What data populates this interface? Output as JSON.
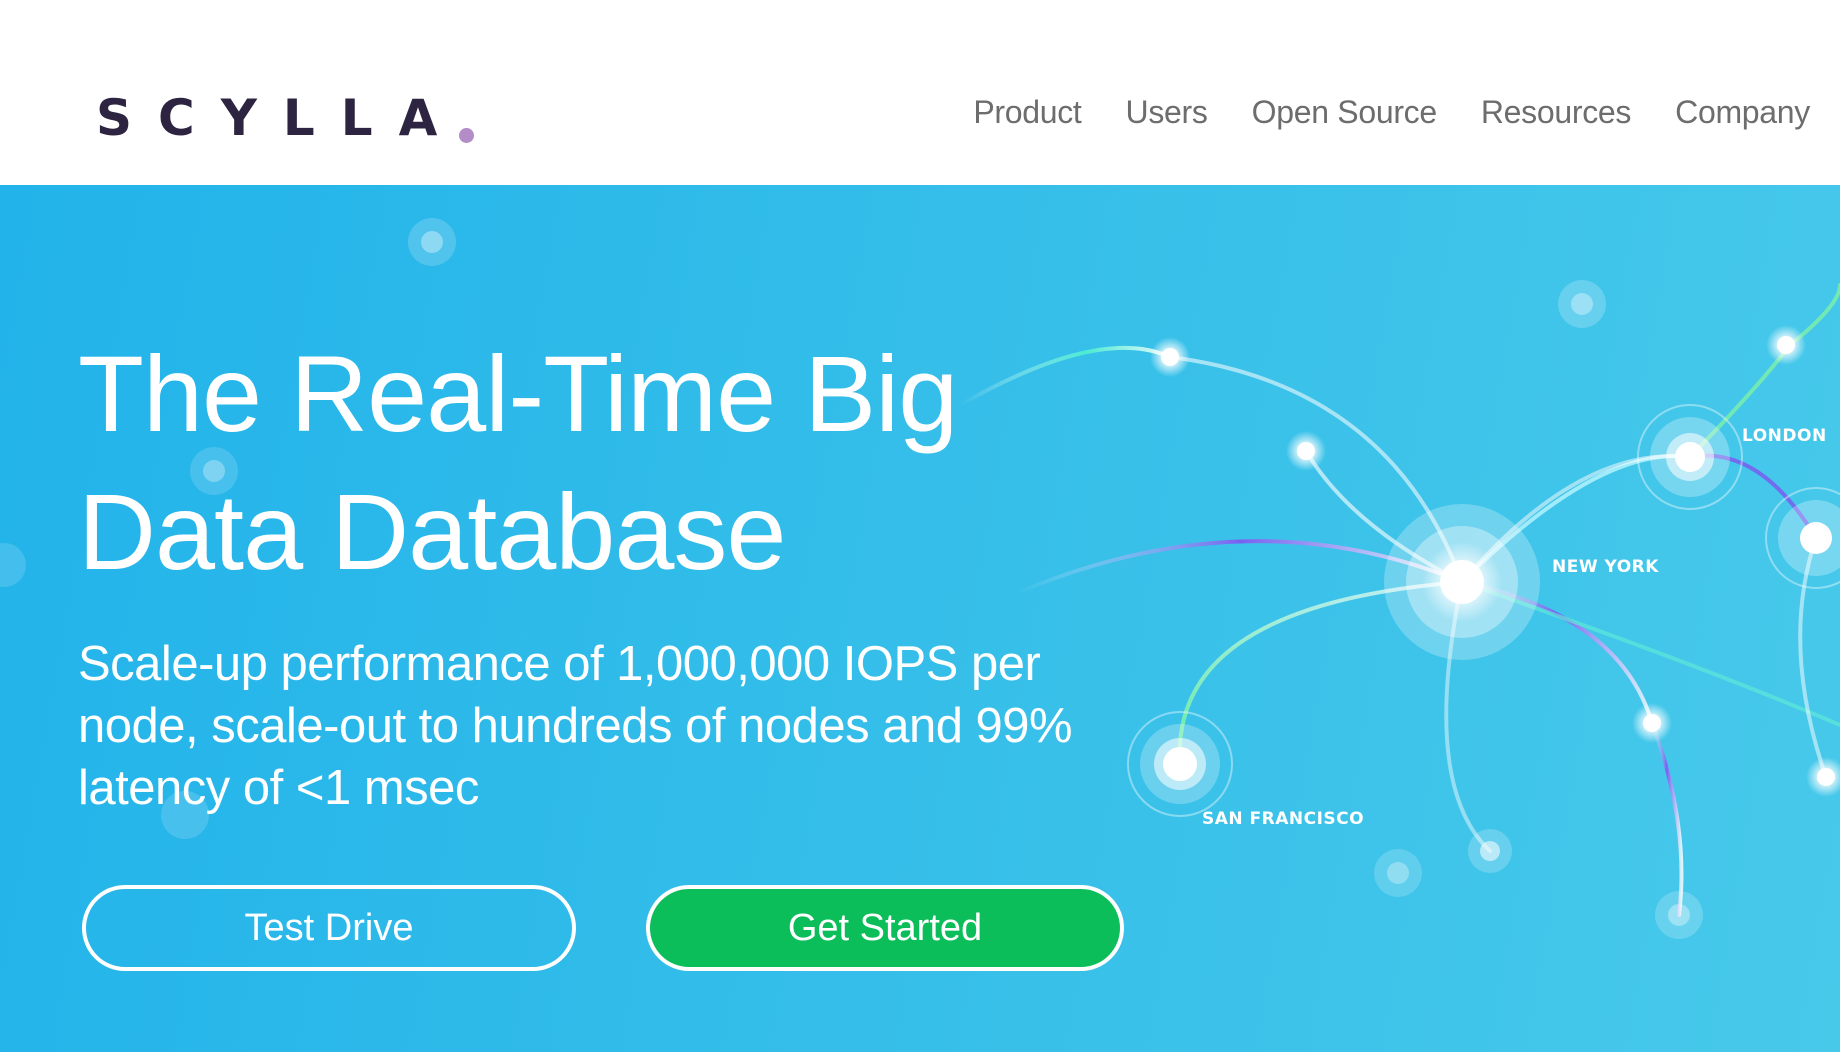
{
  "header": {
    "logo_text": "SCYLLA",
    "nav": [
      "Product",
      "Users",
      "Open Source",
      "Resources",
      "Company"
    ]
  },
  "hero": {
    "headline": "The Real-Time Big Data Database",
    "subheadline": "Scale-up performance of 1,000,000 IOPS per node, scale-out to hundreds of nodes and 99% latency of <1 msec",
    "buttons": {
      "test_drive": "Test Drive",
      "get_started": "Get Started"
    },
    "map_labels": {
      "london": "LONDON",
      "new_york": "NEW YORK",
      "san_francisco": "SAN FRANCISCO"
    }
  },
  "colors": {
    "brand_dark": "#2c2441",
    "brand_dot": "#b48cc8",
    "hero_blue": "#29b6ea",
    "cta_green": "#0cbe5a",
    "nav_text": "#6d6d6d"
  }
}
